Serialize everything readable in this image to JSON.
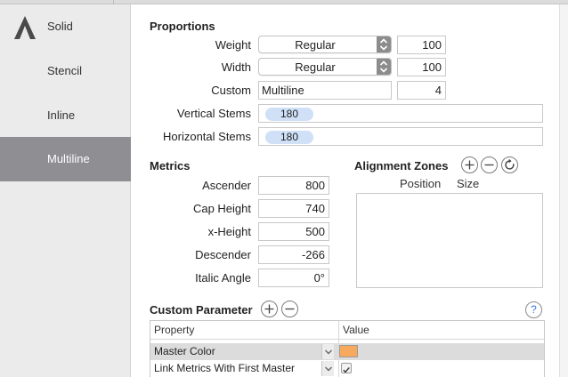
{
  "sidebar": {
    "items": [
      {
        "label": "Solid"
      },
      {
        "label": "Stencil"
      },
      {
        "label": "Inline"
      },
      {
        "label": "Multiline"
      }
    ],
    "active_index": 3
  },
  "proportions": {
    "title": "Proportions",
    "weight": {
      "label": "Weight",
      "popup": "Regular",
      "value": "100"
    },
    "width": {
      "label": "Width",
      "popup": "Regular",
      "value": "100"
    },
    "custom": {
      "label": "Custom",
      "name": "Multiline",
      "value": "4"
    },
    "vertical_stems": {
      "label": "Vertical Stems",
      "token": "180"
    },
    "horizontal_stems": {
      "label": "Horizontal Stems",
      "token": "180"
    }
  },
  "metrics": {
    "title": "Metrics",
    "ascender": {
      "label": "Ascender",
      "value": "800"
    },
    "cap_height": {
      "label": "Cap Height",
      "value": "740"
    },
    "x_height": {
      "label": "x-Height",
      "value": "500"
    },
    "descender": {
      "label": "Descender",
      "value": "-266"
    },
    "italic_angle": {
      "label": "Italic Angle",
      "value": "0°"
    }
  },
  "alignment_zones": {
    "title": "Alignment Zones",
    "col_position": "Position",
    "col_size": "Size"
  },
  "custom_parameter": {
    "title": "Custom Parameter",
    "help": "?",
    "col_property": "Property",
    "col_value": "Value",
    "rows": [
      {
        "property": "Master Color",
        "value_type": "color",
        "color": "#f7a95e"
      },
      {
        "property": "Link Metrics With First Master",
        "value_type": "checkbox",
        "checked": true
      }
    ]
  },
  "colors": {
    "sidebar_active": "#8e8e93",
    "token_bg": "#cfe0f7",
    "selected_row": "#dcdcdc",
    "master_color": "#f7a95e"
  },
  "icons": {
    "logo": "glyphs-logo-icon",
    "add": "plus-icon",
    "remove": "minus-icon",
    "refresh": "refresh-icon",
    "stepper": "up-down-chevron-icon",
    "dropdown": "chevron-down-icon",
    "check": "checkmark-icon"
  }
}
